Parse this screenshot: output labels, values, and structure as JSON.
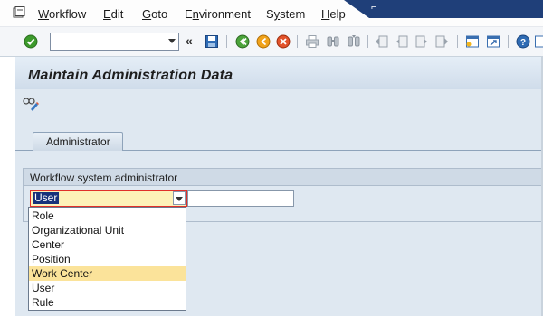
{
  "menu": {
    "items": [
      {
        "label": "Workflow",
        "u": "W",
        "rest": "orkflow"
      },
      {
        "label": "Edit",
        "u": "E",
        "rest": "dit"
      },
      {
        "label": "Goto",
        "u": "G",
        "rest": "oto"
      },
      {
        "label": "Environment",
        "pre": "E",
        "u": "n",
        "rest": "vironment"
      },
      {
        "label": "System",
        "pre": "S",
        "u": "y",
        "rest": "stem"
      },
      {
        "label": "Help",
        "u": "H",
        "rest": "elp"
      }
    ]
  },
  "toolbar": {
    "command_field_value": "",
    "icons": [
      "enter-icon",
      "save-icon",
      "back-icon",
      "exit-icon",
      "cancel-icon",
      "print-icon",
      "find-icon",
      "find-next-icon",
      "first-page-icon",
      "previous-page-icon",
      "next-page-icon",
      "last-page-icon",
      "create-session-icon",
      "shortcut-icon",
      "help-icon",
      "customize-layout-icon"
    ]
  },
  "page": {
    "title": "Maintain Administration Data"
  },
  "tabs": [
    {
      "label": "Administrator",
      "active": true
    }
  ],
  "group": {
    "title": "Workflow system administrator",
    "combo_value": "User",
    "extra_value": ""
  },
  "dropdown": {
    "options": [
      "Role",
      "Organizational Unit",
      "Center",
      "Position",
      "Work Center",
      "User",
      "Rule"
    ],
    "highlighted": "Work Center"
  },
  "colors": {
    "accent_dark": "#1f3f79",
    "selection": "#16327a",
    "highlight": "#fbe39a",
    "combo_bg": "#fdf2b8",
    "combo_border": "#e0302a"
  }
}
